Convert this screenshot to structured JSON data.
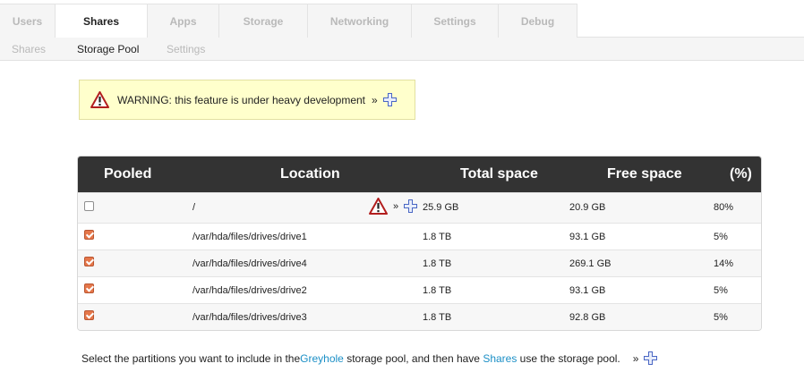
{
  "tabs": [
    {
      "label": "Users",
      "active": false
    },
    {
      "label": "Shares",
      "active": true
    },
    {
      "label": "Apps",
      "active": false
    },
    {
      "label": "Storage",
      "active": false
    },
    {
      "label": "Networking",
      "active": false
    },
    {
      "label": "Settings",
      "active": false
    },
    {
      "label": "Debug",
      "active": false
    }
  ],
  "subnav": [
    {
      "label": "Shares",
      "active": false
    },
    {
      "label": "Storage Pool",
      "active": true
    },
    {
      "label": "Settings",
      "active": false
    }
  ],
  "warning": {
    "text": "WARNING: this feature is under heavy development",
    "more": "»"
  },
  "table": {
    "headers": {
      "pooled": "Pooled",
      "location": "Location",
      "total": "Total space",
      "free": "Free space",
      "pct": "(%)"
    },
    "rows": [
      {
        "pooled": false,
        "location": "/",
        "total": "25.9 GB",
        "free": "20.9 GB",
        "pct": "80%",
        "warning": true,
        "more": "»"
      },
      {
        "pooled": true,
        "location": "/var/hda/files/drives/drive1",
        "total": "1.8 TB",
        "free": "93.1 GB",
        "pct": "5%"
      },
      {
        "pooled": true,
        "location": "/var/hda/files/drives/drive4",
        "total": "1.8 TB",
        "free": "269.1 GB",
        "pct": "14%"
      },
      {
        "pooled": true,
        "location": "/var/hda/files/drives/drive2",
        "total": "1.8 TB",
        "free": "93.1 GB",
        "pct": "5%"
      },
      {
        "pooled": true,
        "location": "/var/hda/files/drives/drive3",
        "total": "1.8 TB",
        "free": "92.8 GB",
        "pct": "5%"
      }
    ]
  },
  "footer": {
    "pre": "Select the partitions you want to include in the ",
    "link1": "Greyhole",
    "mid": " storage pool, and then have ",
    "link2": "Shares",
    "post": " use the storage pool.",
    "more": "»"
  },
  "colors": {
    "accent_link": "#1b8fc6",
    "header_bg": "#333333",
    "warning_bg": "#ffffcc",
    "checkbox_checked": "#e5774a"
  }
}
